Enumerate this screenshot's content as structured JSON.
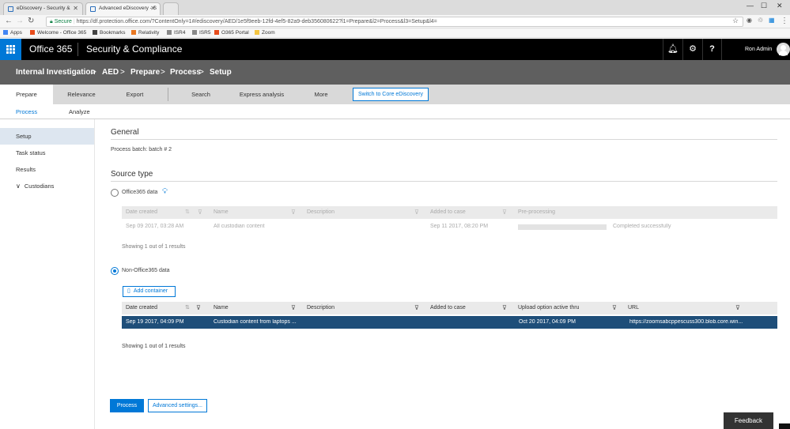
{
  "browser": {
    "tabs": [
      {
        "title": "eDiscovery - Security &",
        "active": false
      },
      {
        "title": "Advanced eDiscovery - S",
        "active": true
      }
    ],
    "secure_label": "Secure",
    "url": "https://df.protection.office.com/?ContentOnly=1#/ediscovery/AED/1e5f9eeb-12fd-4ef5-82a9-deb356080622?l1=Prepare&l2=Process&l3=Setup&l4=",
    "bookmarks": [
      "Apps",
      "Welcome - Office 365",
      "Bookmarks",
      "Relativity",
      "ISR4",
      "ISR5",
      "O365 Portal",
      "Zoom"
    ]
  },
  "header": {
    "app_name": "Office 365",
    "suite_name": "Security & Compliance",
    "user_name": "Ron Admin",
    "icons": [
      "bell-icon",
      "gear-icon",
      "help-icon",
      "avatar-icon"
    ]
  },
  "breadcrumb": {
    "items": [
      "Internal Investigation",
      "AED",
      "Prepare",
      "Process",
      "Setup"
    ],
    "separator": ">"
  },
  "top_tabs": {
    "items": [
      "Prepare",
      "Relevance",
      "Export",
      "Search",
      "Express analysis",
      "More"
    ],
    "active": "Prepare",
    "switch_button": "Switch to Core eDiscovery"
  },
  "sub_tabs": {
    "items": [
      "Process",
      "Analyze"
    ],
    "active": "Process"
  },
  "sidebar": {
    "items": [
      "Setup",
      "Task status",
      "Results",
      "Custodians"
    ],
    "active": "Setup"
  },
  "general": {
    "heading": "General",
    "batch_text": "Process batch: batch # 2"
  },
  "source_type": {
    "heading": "Source type",
    "office365": {
      "label": "Office365 data",
      "selected": false,
      "columns": [
        "Date created",
        "Name",
        "Description",
        "Added to case",
        "Pre-processing"
      ],
      "rows": [
        {
          "date_created": "Sep 09 2017, 03:28 AM",
          "name": "All custodian content",
          "description": "",
          "added_to_case": "Sep 11 2017, 08:20 PM",
          "preprocessing_status": "Completed successfully",
          "progress_fraction": 1.0
        }
      ],
      "count_text": "Showing 1 out of 1 results"
    },
    "non_office365": {
      "label": "Non-Office365 data",
      "selected": true,
      "add_button": "Add container",
      "columns": [
        "Date created",
        "Name",
        "Description",
        "Added to case",
        "Upload option active thru",
        "URL"
      ],
      "rows": [
        {
          "date_created": "Sep 19 2017, 04:09 PM",
          "name": "Custodian content from laptops ...",
          "description": "",
          "added_to_case": "",
          "upload_active_thru": "Oct 20 2017, 04:09 PM",
          "url": "https://zoomsabcppescuss300.blob.core.win...",
          "selected": true
        }
      ],
      "count_text": "Showing 1 out of 1 results"
    }
  },
  "actions": {
    "process_button": "Process",
    "advanced_button": "Advanced settings..."
  },
  "feedback_button": "Feedback",
  "colors": {
    "accent": "#0078d7",
    "header_bg": "#000000",
    "breadcrumb_bg": "#5f5f5f",
    "selected_row": "#1e4e79",
    "sidebar_active": "#dde6f0"
  }
}
